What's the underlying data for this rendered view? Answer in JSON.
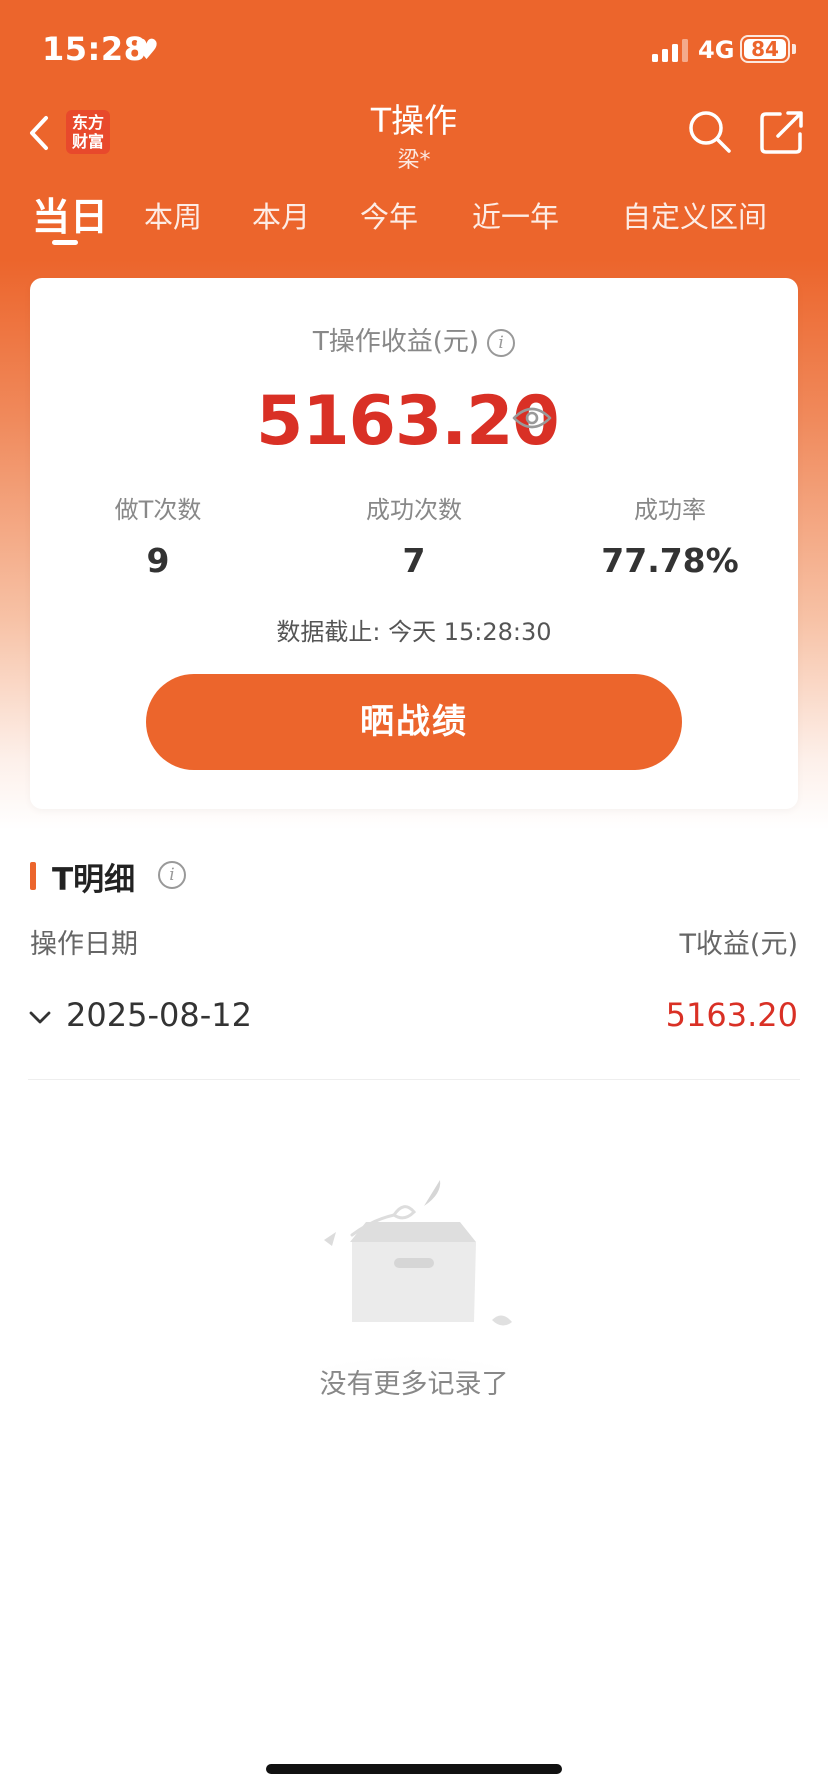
{
  "status_bar": {
    "time": "15:28",
    "network": "4G",
    "battery": "84"
  },
  "header": {
    "title": "T操作",
    "subtitle": "梁*",
    "logo_text": "东方财富"
  },
  "tabs": [
    {
      "label": "当日",
      "active": true
    },
    {
      "label": "本周",
      "active": false
    },
    {
      "label": "本月",
      "active": false
    },
    {
      "label": "今年",
      "active": false
    },
    {
      "label": "近一年",
      "active": false
    },
    {
      "label": "自定义区间",
      "active": false
    }
  ],
  "summary": {
    "label": "T操作收益(元)",
    "value": "5163.20",
    "stats": [
      {
        "label": "做T次数",
        "value": "9"
      },
      {
        "label": "成功次数",
        "value": "7"
      },
      {
        "label": "成功率",
        "value": "77.78%"
      }
    ],
    "data_time": "数据截止: 今天 15:28:30",
    "share_button": "晒战绩"
  },
  "detail": {
    "title": "T明细",
    "col_date": "操作日期",
    "col_profit": "T收益(元)",
    "rows": [
      {
        "date": "2025-08-12",
        "profit": "5163.20"
      }
    ],
    "empty_text": "没有更多记录了"
  },
  "colors": {
    "brand": "#ec652c",
    "profit_red": "#d93025"
  }
}
